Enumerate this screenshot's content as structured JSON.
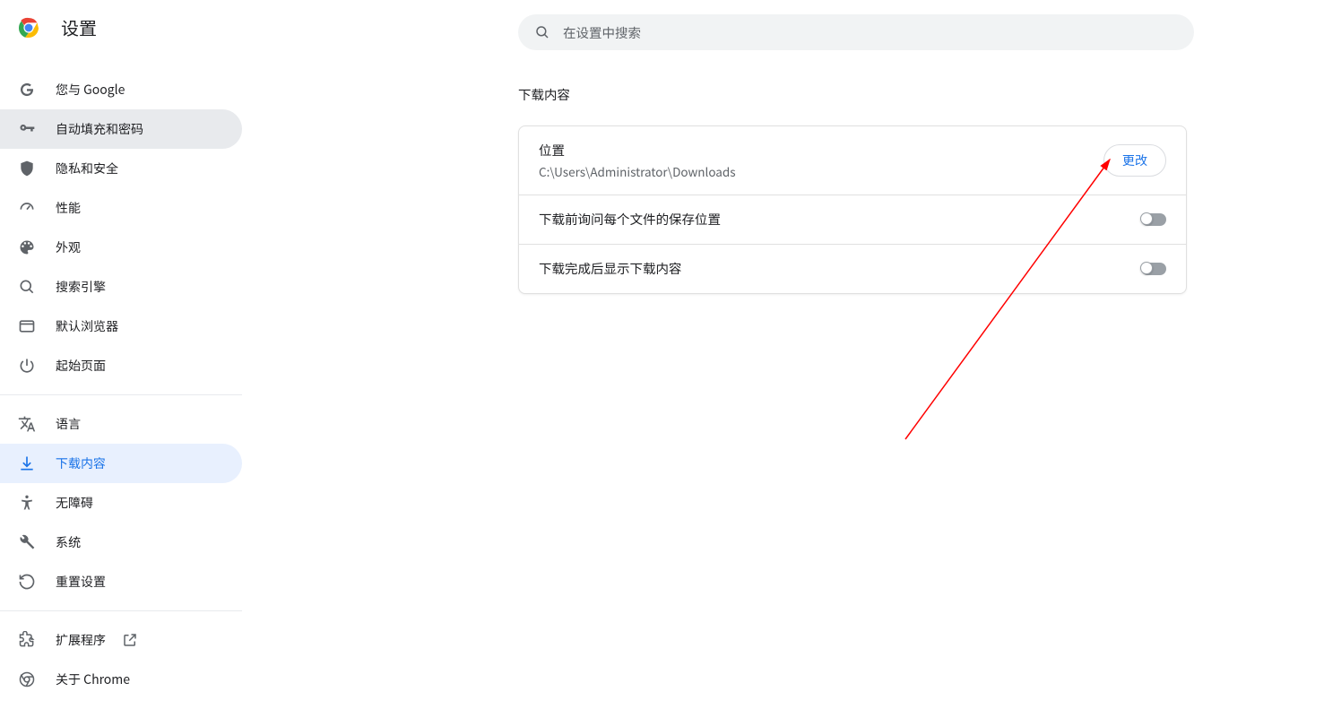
{
  "page": {
    "title": "设置"
  },
  "search": {
    "placeholder": "在设置中搜索",
    "value": ""
  },
  "sidebar": {
    "items": [
      "您与 Google",
      "自动填充和密码",
      "隐私和安全",
      "性能",
      "外观",
      "搜索引擎",
      "默认浏览器",
      "起始页面"
    ],
    "items2": [
      "语言",
      "下载内容",
      "无障碍",
      "系统",
      "重置设置"
    ],
    "items3": [
      "扩展程序",
      "关于 Chrome"
    ]
  },
  "main": {
    "section_title": "下载内容",
    "rows": {
      "location": {
        "title": "位置",
        "path": "C:\\Users\\Administrator\\Downloads",
        "button": "更改"
      },
      "ask": {
        "title": "下载前询问每个文件的保存位置"
      },
      "show": {
        "title": "下载完成后显示下载内容"
      }
    }
  },
  "colors": {
    "accent": "#1a73e8"
  }
}
